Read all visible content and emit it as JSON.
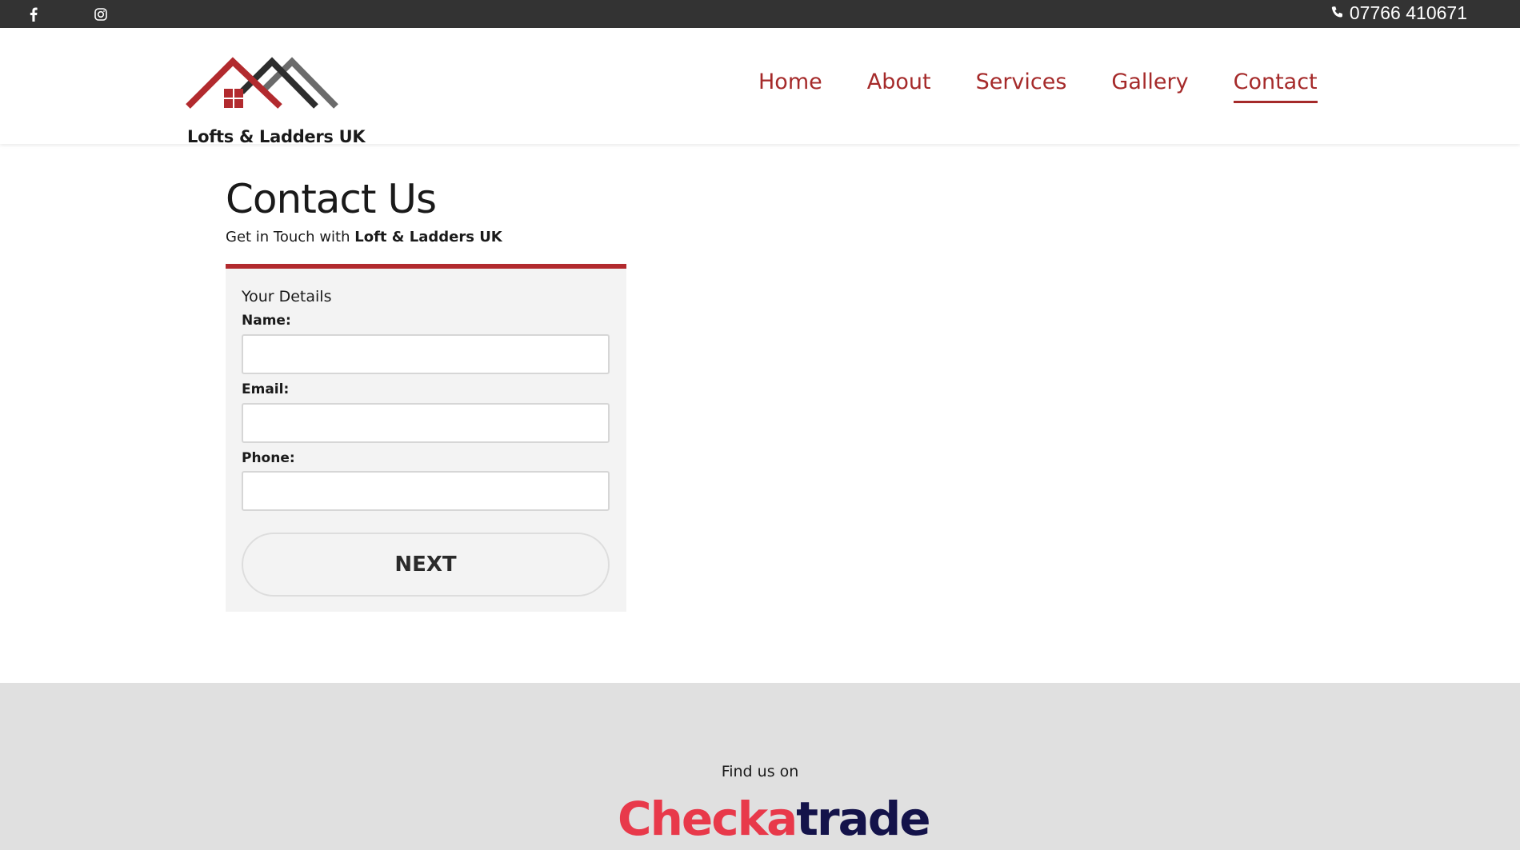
{
  "topbar": {
    "social": [
      {
        "name": "facebook-icon",
        "glyph": "f"
      },
      {
        "name": "instagram-icon",
        "glyph": "◎"
      }
    ],
    "phone_icon": "phone-icon",
    "phone": "07766 410671"
  },
  "header": {
    "logo_text": "Lofts & Ladders UK",
    "nav": [
      {
        "label": "Home",
        "active": false
      },
      {
        "label": "About",
        "active": false
      },
      {
        "label": "Services",
        "active": false
      },
      {
        "label": "Gallery",
        "active": false
      },
      {
        "label": "Contact",
        "active": true
      }
    ]
  },
  "main": {
    "title": "Contact Us",
    "subtitle_prefix": "Get in Touch with ",
    "subtitle_bold": "Loft & Ladders UK",
    "form": {
      "section_title": "Your Details",
      "fields": [
        {
          "label": "Name:",
          "value": "",
          "placeholder": ""
        },
        {
          "label": "Email:",
          "value": "",
          "placeholder": ""
        },
        {
          "label": "Phone:",
          "value": "",
          "placeholder": ""
        }
      ],
      "next_label": "NEXT"
    }
  },
  "footer": {
    "find_us": "Find us on",
    "brand_part1": "Checka",
    "brand_part2": "trade"
  },
  "colors": {
    "accent": "#a52a2a",
    "topbar_bg": "#333333",
    "footer_bg": "#e0e0e0",
    "form_bg": "#f3f3f3",
    "form_border": "#b22a2e",
    "checkatrade_red": "#e8394a",
    "checkatrade_navy": "#14134a"
  }
}
